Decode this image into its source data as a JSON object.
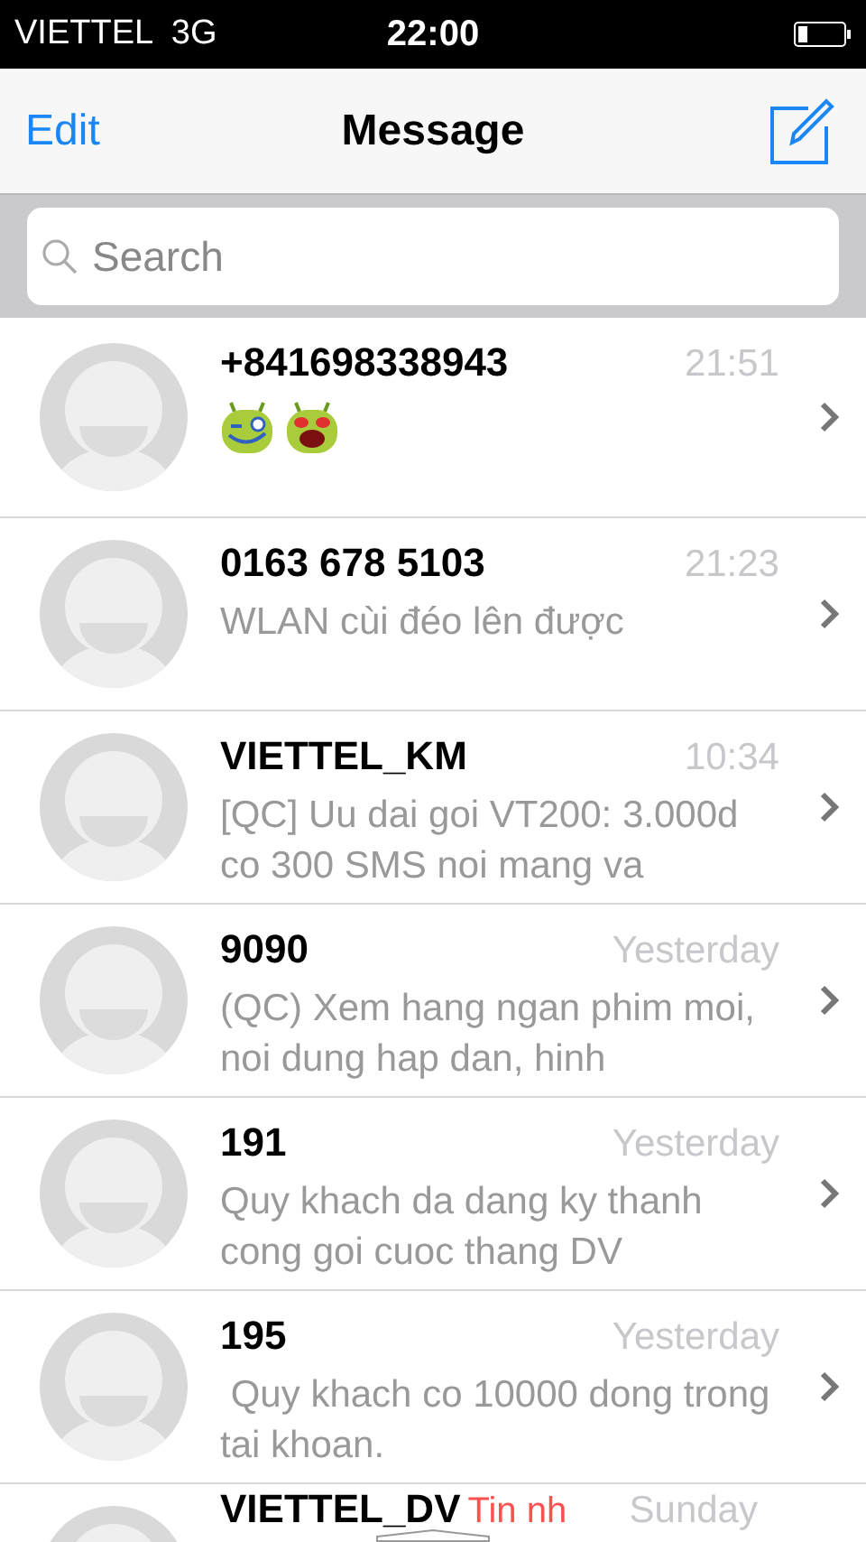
{
  "status_bar": {
    "carrier": "VIETTEL  3G",
    "time": "22:00"
  },
  "nav": {
    "edit": "Edit",
    "title": "Message"
  },
  "search": {
    "placeholder": "Search"
  },
  "conversations": [
    {
      "name": "+841698338943",
      "time": "21:51",
      "message": {
        "kind": "emoji"
      }
    },
    {
      "name": "0163 678 5103",
      "time": "21:23",
      "message": {
        "kind": "text",
        "text": "WLAN cùi đéo lên được"
      }
    },
    {
      "name": "VIETTEL_KM",
      "time": "10:34",
      "message": {
        "kind": "text",
        "text": "[QC] Uu dai goi VT200: 3.000d co 300 SMS noi mang va"
      }
    },
    {
      "name": "9090",
      "time": "Yesterday",
      "message": {
        "kind": "text",
        "text": "(QC) Xem hang ngan phim moi, noi dung hap dan, hinh"
      }
    },
    {
      "name": "191",
      "time": "Yesterday",
      "message": {
        "kind": "text",
        "text": "Quy khach da dang ky thanh cong goi cuoc thang DV"
      }
    },
    {
      "name": "195",
      "time": "Yesterday",
      "message": {
        "kind": "text",
        "text": " Quy khach co 10000 dong trong tai khoan."
      }
    },
    {
      "name": "VIETTEL_DV",
      "tag": "Tin nh",
      "time": "Sunday"
    }
  ]
}
